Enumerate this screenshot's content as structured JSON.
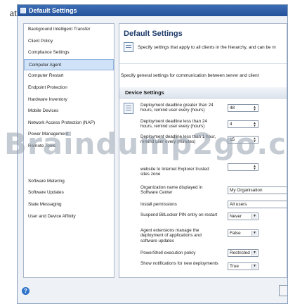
{
  "background_text": "at",
  "window": {
    "title": "Default Settings"
  },
  "sidebar": {
    "items": [
      {
        "label": "Background Intelligent Transfer",
        "selected": false
      },
      {
        "label": "Client Policy",
        "selected": false
      },
      {
        "label": "Compliance Settings",
        "selected": false
      },
      {
        "label": "Computer Agent",
        "selected": true
      },
      {
        "label": "Computer Restart",
        "selected": false
      },
      {
        "label": "Endpoint Protection",
        "selected": false
      },
      {
        "label": "Hardware Inventory",
        "selected": false
      },
      {
        "label": "Mobile Devices",
        "selected": false
      },
      {
        "label": "Network Access Protection (NAP)",
        "selected": false
      },
      {
        "label": "Power Management",
        "selected": false
      },
      {
        "label": "Remote Tools",
        "selected": false
      },
      {
        "label": "",
        "selected": false
      },
      {
        "label": "",
        "selected": false
      },
      {
        "label": "Software Metering",
        "selected": false
      },
      {
        "label": "Software Updates",
        "selected": false
      },
      {
        "label": "State Messaging",
        "selected": false
      },
      {
        "label": "User and Device Affinity",
        "selected": false
      }
    ]
  },
  "content": {
    "title": "Default Settings",
    "header_desc": "Specify settings that apply to all clients in the hierarchy, and can be m",
    "general_desc": "Specify general settings for communication between server and client",
    "section_title": "Device Settings",
    "settings": [
      {
        "label": "Deployment deadline greater than 24 hours, remind user every (hours)",
        "value": "48",
        "control": "spin"
      },
      {
        "label": "Deployment deadline less than 24 hours, remind user every (hours)",
        "value": "4",
        "control": "spin"
      },
      {
        "label": "Deployment deadline less than 1 hour, remind user every (minutes)",
        "value": "15",
        "control": "spin"
      },
      {
        "label": "website to Internet Explorer trusted sites zone",
        "value": "",
        "control": "none"
      },
      {
        "label": "Organization name displayed in Software Center",
        "value": "My Organisation",
        "control": "text"
      },
      {
        "label": "Install permissions",
        "value": "All users",
        "control": "text"
      },
      {
        "label": "Suspend BitLocker PIN entry on restart",
        "value": "Never",
        "control": "select"
      },
      {
        "label": "Agent extensions manage the deployment of applications and software updates",
        "value": "False",
        "control": "select"
      },
      {
        "label": "PowerShell execution policy",
        "value": "Restricted",
        "control": "select"
      },
      {
        "label": "Show notifications for new deployments",
        "value": "True",
        "control": "select"
      }
    ]
  },
  "watermark": "Braindump2go.c",
  "icons": {
    "app": "settings-window-icon",
    "header": "settings-document-icon",
    "section": "device-settings-icon",
    "help": "help-icon",
    "spin": "spin-arrows-icon",
    "dropdown": "chevron-down-icon"
  },
  "colors": {
    "titlebar": "#2f5fa8",
    "selection": "#cfe2f8",
    "heading": "#1f3c6b",
    "help": "#2f74c9"
  }
}
